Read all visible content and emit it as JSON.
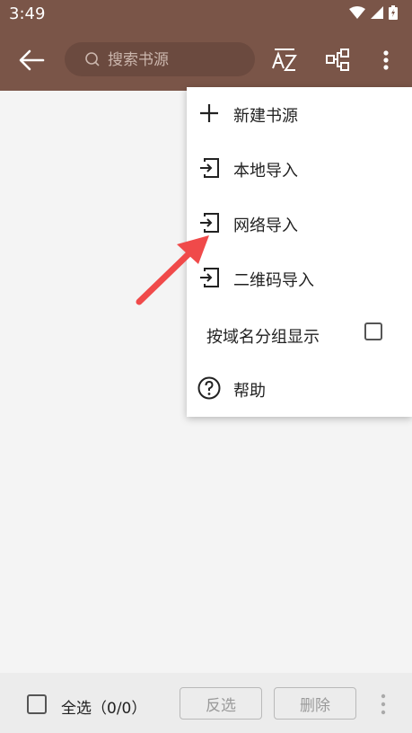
{
  "status": {
    "time": "3:49"
  },
  "toolbar": {
    "search_placeholder": "搜索书源"
  },
  "menu": {
    "items": [
      {
        "label": "新建书源"
      },
      {
        "label": "本地导入"
      },
      {
        "label": "网络导入"
      },
      {
        "label": "二维码导入"
      },
      {
        "label": "按域名分组显示"
      },
      {
        "label": "帮助"
      }
    ]
  },
  "bottom": {
    "select_all": "全选（0/0）",
    "invert": "反选",
    "delete": "删除"
  },
  "colors": {
    "primary": "#7a5548",
    "annotation_arrow": "#f04a4a"
  }
}
